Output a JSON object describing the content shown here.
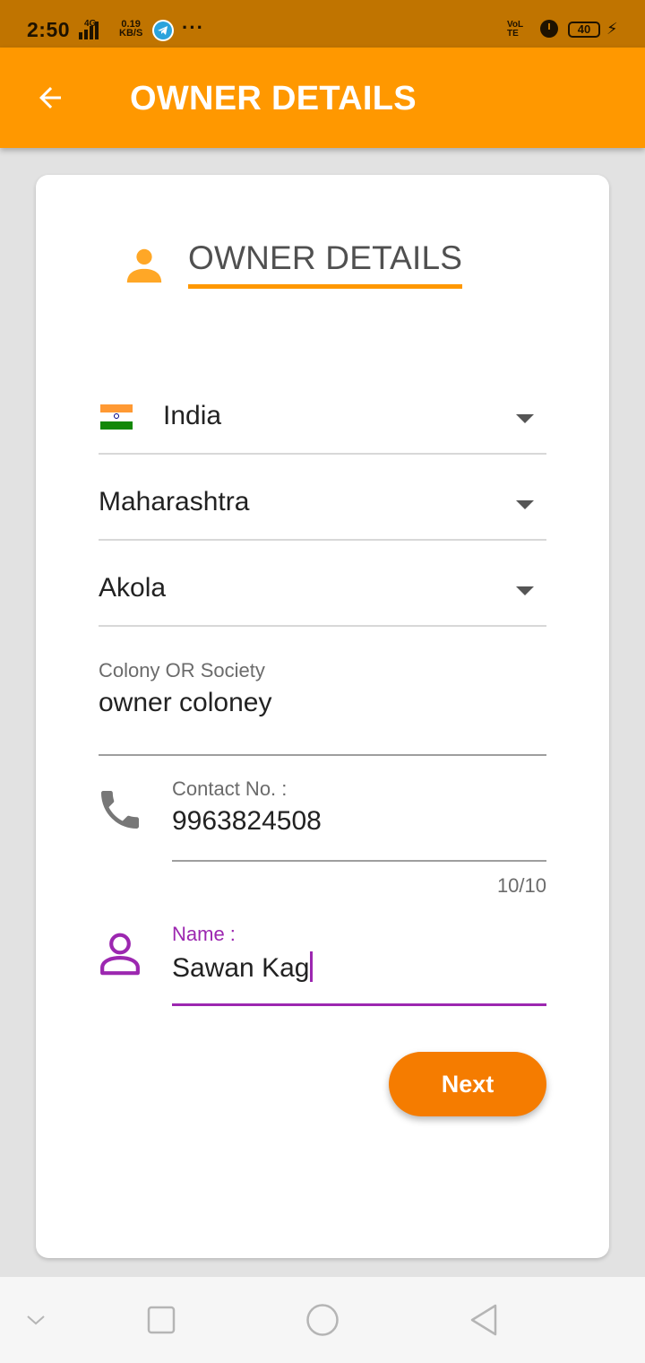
{
  "status_bar": {
    "time": "2:50",
    "network": "4G",
    "speed_value": "0.19",
    "speed_unit": "KB/S",
    "more": "···",
    "volte": "VoLTE",
    "battery": "40"
  },
  "app_bar": {
    "title": "OWNER DETAILS",
    "back_icon": "arrow-left-icon"
  },
  "section": {
    "title": "OWNER DETAILS",
    "icon": "person-icon",
    "accent_color": "#ff9800"
  },
  "form": {
    "country": {
      "value": "India",
      "flag": "india-flag-icon"
    },
    "state": {
      "value": "Maharashtra"
    },
    "city": {
      "value": "Akola"
    },
    "colony": {
      "label": "Colony OR Society",
      "value": "owner coloney"
    },
    "contact": {
      "label": "Contact No. :",
      "value": "9963824508",
      "counter": "10/10",
      "icon": "phone-icon"
    },
    "name": {
      "label": "Name :",
      "value": "Sawan Kag",
      "icon": "person-outline-icon",
      "focus_color": "#9c27b0"
    }
  },
  "actions": {
    "next_label": "Next"
  },
  "nav_bar": {
    "items": [
      "chevron-down-icon",
      "square-icon",
      "circle-icon",
      "triangle-back-icon"
    ]
  }
}
